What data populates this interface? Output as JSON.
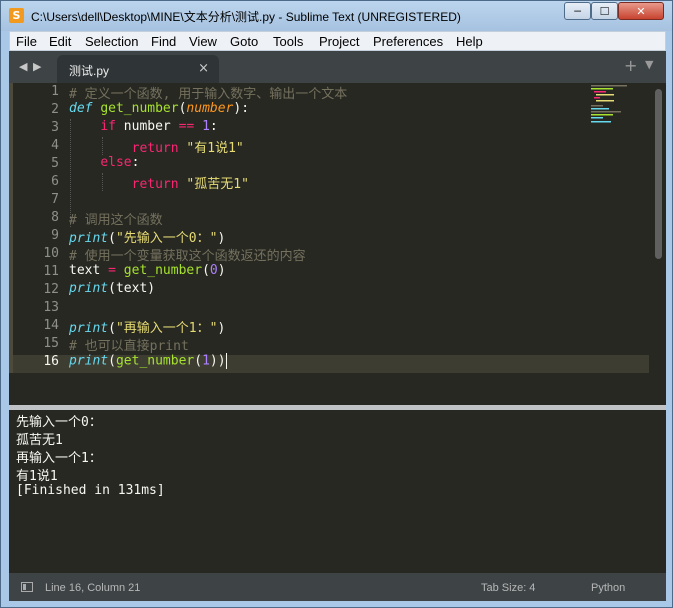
{
  "window": {
    "title": "C:\\Users\\dell\\Desktop\\MINE\\文本分析\\测试.py - Sublime Text (UNREGISTERED)",
    "app_icon": "S",
    "controls": {
      "minimize": "─",
      "maximize": "☐",
      "close": "✕"
    }
  },
  "menu": [
    "File",
    "Edit",
    "Selection",
    "Find",
    "View",
    "Goto",
    "Tools",
    "Project",
    "Preferences",
    "Help"
  ],
  "tabs": {
    "nav_left": "◀",
    "nav_right": "▶",
    "active": "测试.py",
    "close": "×",
    "new_tab": "+",
    "menu": "▼"
  },
  "editor": {
    "line_numbers": [
      "1",
      "2",
      "3",
      "4",
      "5",
      "6",
      "7",
      "8",
      "9",
      "10",
      "11",
      "12",
      "13",
      "14",
      "15",
      "16"
    ],
    "current_line": 16,
    "lines": [
      [
        {
          "t": "c",
          "v": "# 定义一个函数, 用于输入数字、输出一个文本"
        }
      ],
      [
        {
          "t": "def",
          "v": "def"
        },
        {
          "t": "",
          "v": " "
        },
        {
          "t": "fn",
          "v": "get_number"
        },
        {
          "t": "",
          "v": "("
        },
        {
          "t": "arg",
          "v": "number"
        },
        {
          "t": "",
          "v": "):"
        }
      ],
      [
        {
          "t": "",
          "v": "    "
        },
        {
          "t": "kw",
          "v": "if"
        },
        {
          "t": "",
          "v": " number "
        },
        {
          "t": "kw",
          "v": "=="
        },
        {
          "t": "",
          "v": " "
        },
        {
          "t": "num",
          "v": "1"
        },
        {
          "t": "",
          "v": ":"
        }
      ],
      [
        {
          "t": "",
          "v": "        "
        },
        {
          "t": "kw",
          "v": "return"
        },
        {
          "t": "",
          "v": " "
        },
        {
          "t": "str",
          "v": "\"有1说1\""
        }
      ],
      [
        {
          "t": "",
          "v": "    "
        },
        {
          "t": "kw",
          "v": "else"
        },
        {
          "t": "",
          "v": ":"
        }
      ],
      [
        {
          "t": "",
          "v": "        "
        },
        {
          "t": "kw",
          "v": "return"
        },
        {
          "t": "",
          "v": " "
        },
        {
          "t": "str",
          "v": "\"孤苦无1\""
        }
      ],
      [],
      [
        {
          "t": "c",
          "v": "# 调用这个函数"
        }
      ],
      [
        {
          "t": "bi",
          "v": "print"
        },
        {
          "t": "",
          "v": "("
        },
        {
          "t": "str",
          "v": "\"先输入一个0：\""
        },
        {
          "t": "",
          "v": ")"
        }
      ],
      [
        {
          "t": "c",
          "v": "# 使用一个变量获取这个函数返还的内容"
        }
      ],
      [
        {
          "t": "",
          "v": "text "
        },
        {
          "t": "kw",
          "v": "="
        },
        {
          "t": "",
          "v": " "
        },
        {
          "t": "fn",
          "v": "get_number"
        },
        {
          "t": "",
          "v": "("
        },
        {
          "t": "num",
          "v": "0"
        },
        {
          "t": "",
          "v": ")"
        }
      ],
      [
        {
          "t": "bi",
          "v": "print"
        },
        {
          "t": "",
          "v": "(text)"
        }
      ],
      [],
      [
        {
          "t": "bi",
          "v": "print"
        },
        {
          "t": "",
          "v": "("
        },
        {
          "t": "str",
          "v": "\"再输入一个1：\""
        },
        {
          "t": "",
          "v": ")"
        }
      ],
      [
        {
          "t": "c",
          "v": "# 也可以直接print"
        }
      ],
      [
        {
          "t": "bi",
          "v": "print"
        },
        {
          "t": "",
          "v": "("
        },
        {
          "t": "fn",
          "v": "get_number"
        },
        {
          "t": "",
          "v": "("
        },
        {
          "t": "num",
          "v": "1"
        },
        {
          "t": "",
          "v": "))"
        }
      ]
    ]
  },
  "console": {
    "lines": [
      "先输入一个0：",
      "孤苦无1",
      "再输入一个1：",
      "有1说1",
      "[Finished in 131ms]"
    ]
  },
  "status": {
    "position": "Line 16, Column 21",
    "tab_size": "Tab Size: 4",
    "syntax": "Python"
  },
  "colors": {
    "background": "#272822",
    "comment": "#75715e",
    "keyword": "#f92672",
    "function": "#a6e22e",
    "string": "#e6db74",
    "number": "#ae81ff",
    "argument": "#fd971f",
    "builtin": "#66d9ef"
  }
}
